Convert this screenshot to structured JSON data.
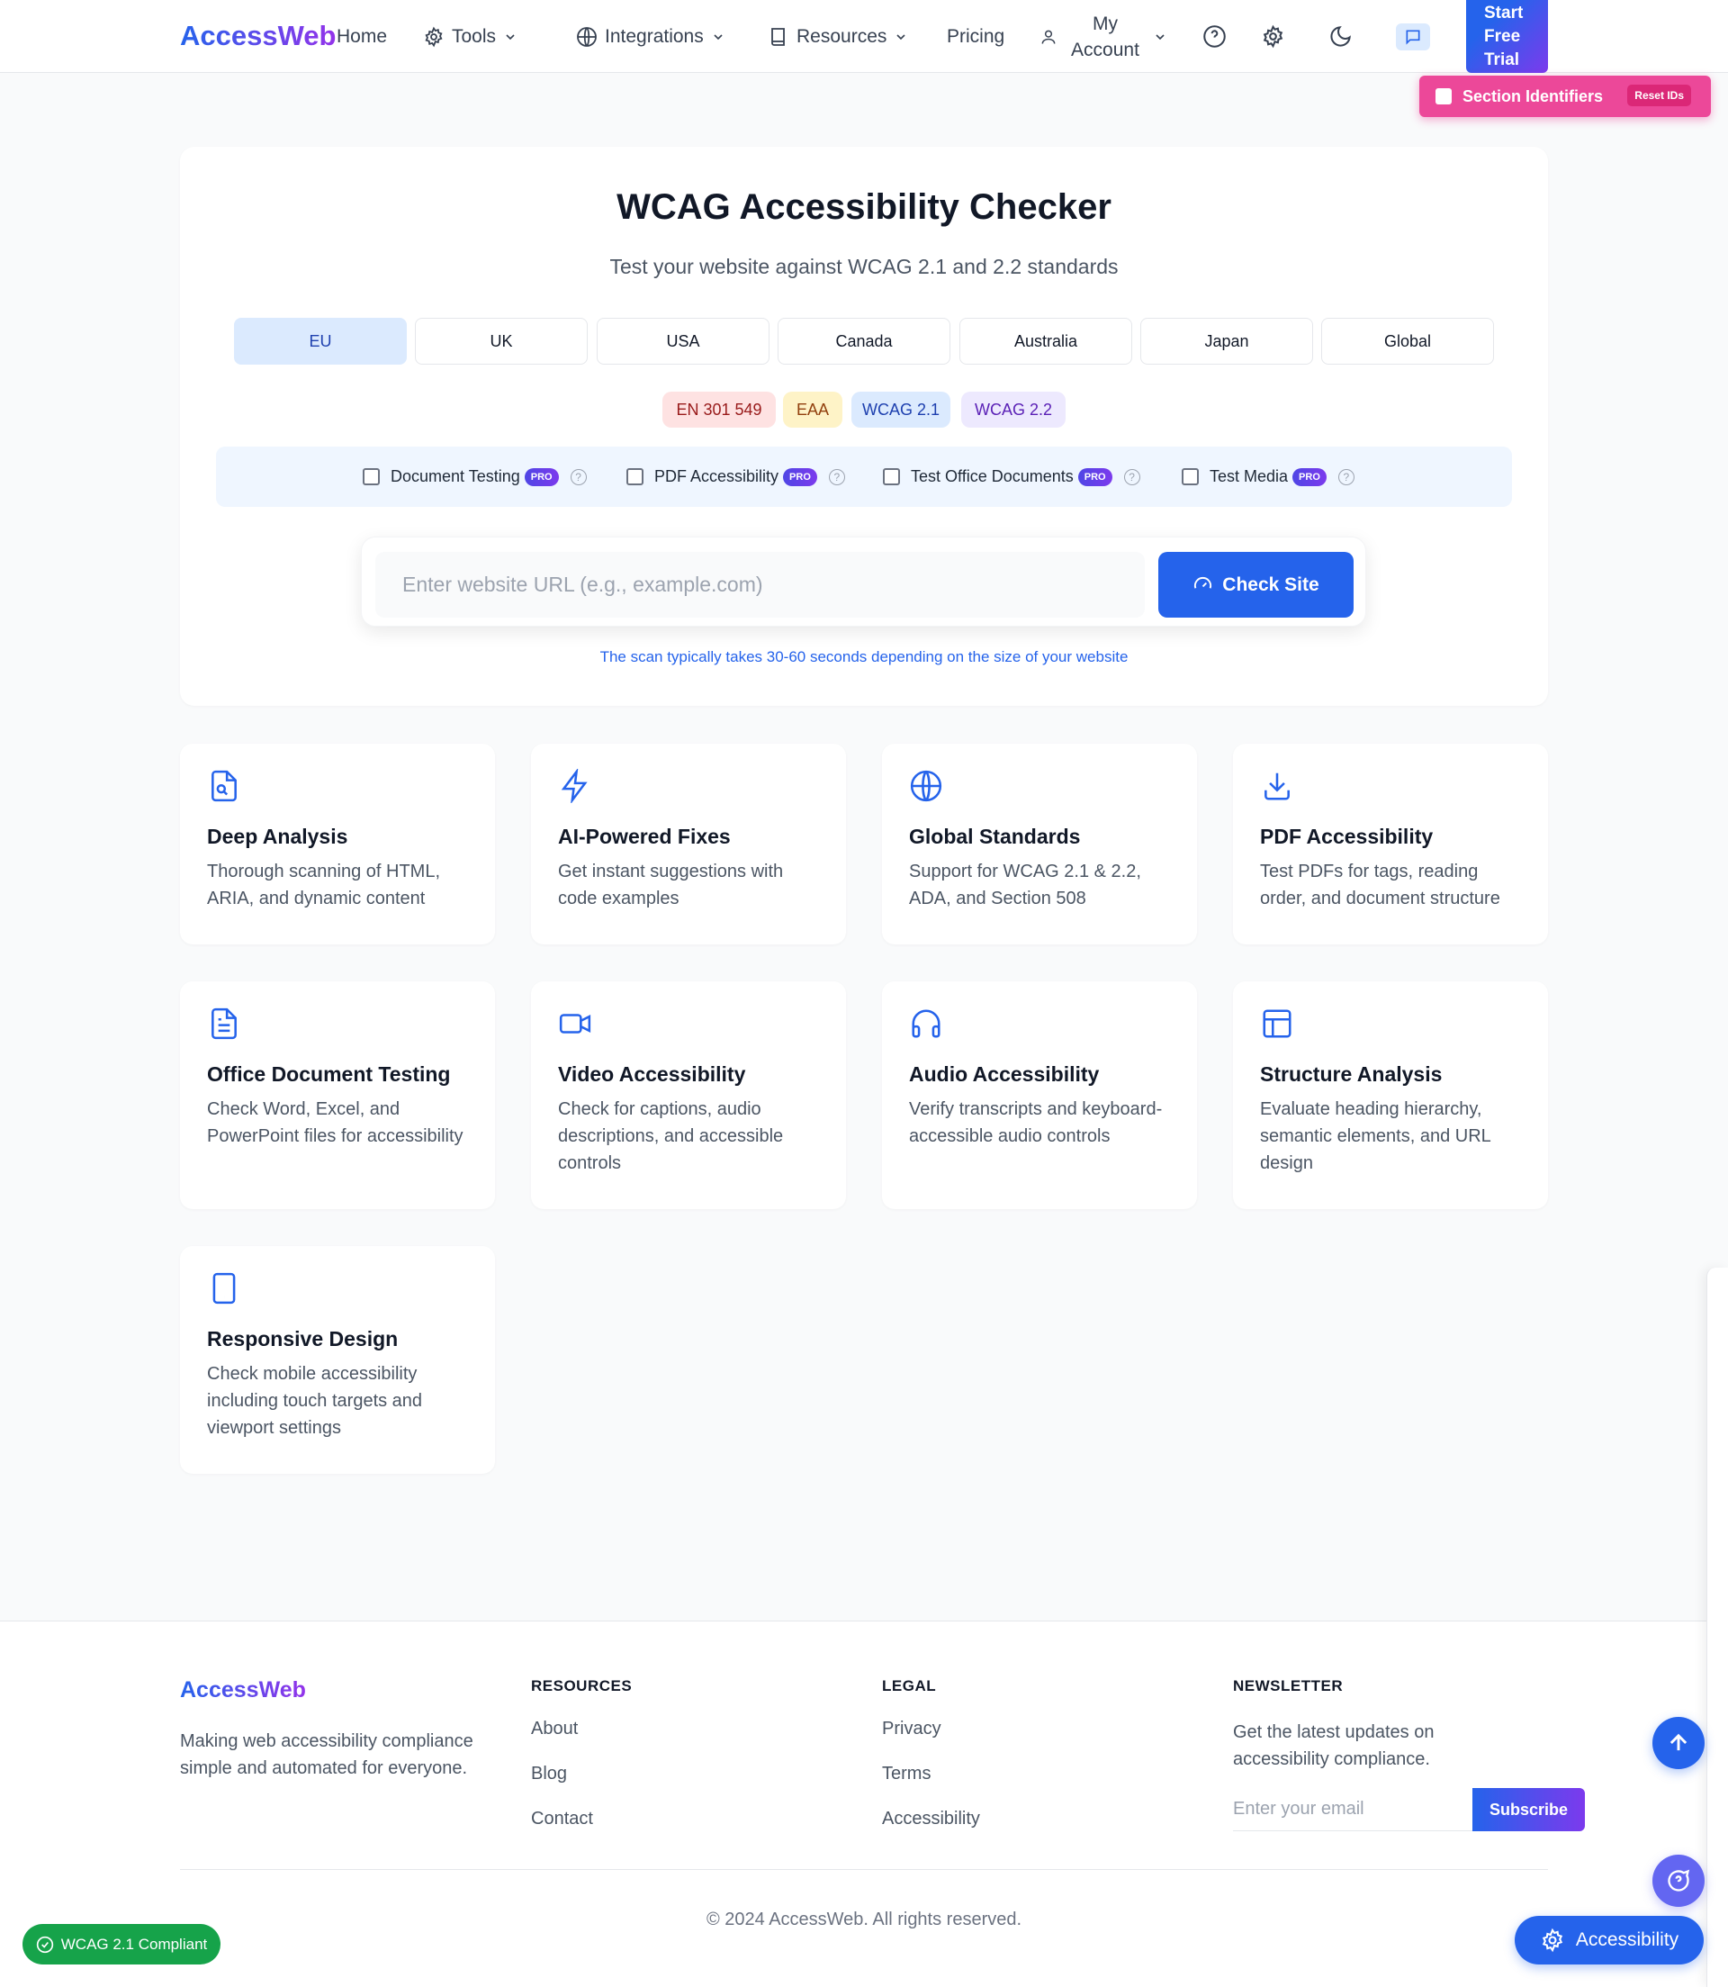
{
  "nav": {
    "brand": "AccessWeb",
    "home": "Home",
    "tools": "Tools",
    "integrations": "Integrations",
    "resources": "Resources",
    "pricing": "Pricing",
    "account": "My Account",
    "trial": "Start Free Trial"
  },
  "section_ids": {
    "label": "Section Identifiers",
    "reset": "Reset IDs"
  },
  "checker": {
    "title": "WCAG Accessibility Checker",
    "subtitle": "Test your website against WCAG 2.1 and 2.2 standards",
    "regions": [
      "EU",
      "UK",
      "USA",
      "Canada",
      "Australia",
      "Japan",
      "Global"
    ],
    "active_region": "EU",
    "standards": [
      {
        "label": "EN 301 549",
        "bg": "#fee2e2",
        "color": "#991b1b"
      },
      {
        "label": "EAA",
        "bg": "#fef3c7",
        "color": "#92400e"
      },
      {
        "label": "WCAG 2.1",
        "bg": "#dbeafe",
        "color": "#1e40af"
      },
      {
        "label": "WCAG 2.2",
        "bg": "#ede9fe",
        "color": "#5b21b6"
      }
    ],
    "options": [
      {
        "label": "Document Testing",
        "badge": "PRO",
        "help": "?"
      },
      {
        "label": "PDF Accessibility",
        "badge": "PRO",
        "help": "?"
      },
      {
        "label": "Test Office Documents",
        "badge": "PRO",
        "help": "?"
      },
      {
        "label": "Test Media",
        "badge": "PRO",
        "help": "?"
      }
    ],
    "url_placeholder": "Enter website URL (e.g., example.com)",
    "check_button": "Check Site",
    "scan_note": "The scan typically takes 30-60 seconds depending on the size of your website"
  },
  "features": [
    {
      "icon": "file-search-icon",
      "title": "Deep Analysis",
      "desc": "Thorough scanning of HTML, ARIA, and dynamic content"
    },
    {
      "icon": "lightning-icon",
      "title": "AI-Powered Fixes",
      "desc": "Get instant suggestions with code examples"
    },
    {
      "icon": "globe-icon",
      "title": "Global Standards",
      "desc": "Support for WCAG 2.1 & 2.2, ADA, and Section 508"
    },
    {
      "icon": "download-icon",
      "title": "PDF Accessibility",
      "desc": "Test PDFs for tags, reading order, and document structure"
    },
    {
      "icon": "document-icon",
      "title": "Office Document Testing",
      "desc": "Check Word, Excel, and PowerPoint files for accessibility"
    },
    {
      "icon": "video-icon",
      "title": "Video Accessibility",
      "desc": "Check for captions, audio descriptions, and accessible controls"
    },
    {
      "icon": "headphones-icon",
      "title": "Audio Accessibility",
      "desc": "Verify transcripts and keyboard-accessible audio controls"
    },
    {
      "icon": "layout-icon",
      "title": "Structure Analysis",
      "desc": "Evaluate heading hierarchy, semantic elements, and URL design"
    },
    {
      "icon": "tablet-icon",
      "title": "Responsive Design",
      "desc": "Check mobile accessibility including touch targets and viewport settings"
    }
  ],
  "footer": {
    "brand": "AccessWeb",
    "desc": "Making web accessibility compliance simple and automated for everyone.",
    "resources_head": "RESOURCES",
    "resources": [
      "About",
      "Blog",
      "Contact"
    ],
    "legal_head": "LEGAL",
    "legal": [
      "Privacy",
      "Terms",
      "Accessibility"
    ],
    "newsletter_head": "NEWSLETTER",
    "newsletter_desc": "Get the latest updates on accessibility compliance.",
    "email_placeholder": "Enter your email",
    "subscribe": "Subscribe",
    "copyright": "© 2024 AccessWeb. All rights reserved."
  },
  "floating": {
    "accessibility": "Accessibility",
    "compliant": "WCAG 2.1 Compliant"
  }
}
